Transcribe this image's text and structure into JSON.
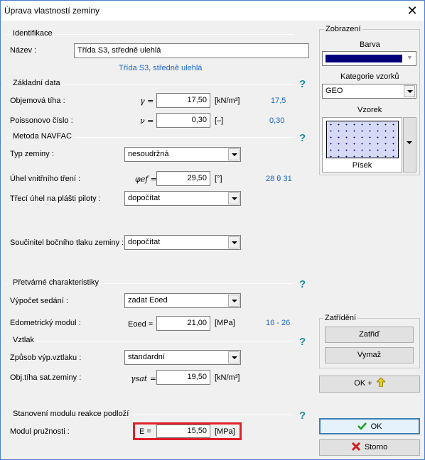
{
  "window": {
    "title": "Úprava vlastností zeminy",
    "close_glyph": "✕"
  },
  "identifikace": {
    "section": "Identifikace",
    "nazev_label": "Název :",
    "nazev_value": "Třída S3, středně ulehlá",
    "nazev_hint": "Třída S3, středně ulehlá"
  },
  "zakladni": {
    "section": "Základní data",
    "help": "?",
    "objem_label": "Objemová tíha :",
    "objem_symbol": "γ =",
    "objem_value": "17,50",
    "objem_unit": "[kN/m³]",
    "objem_hint": "17,5",
    "poisson_label": "Poissonovo číslo :",
    "poisson_symbol": "ν =",
    "poisson_value": "0,30",
    "poisson_unit": "[–]",
    "poisson_hint": "0,30"
  },
  "navfac": {
    "section": "Metoda NAVFAC",
    "help": "?",
    "typ_label": "Typ zeminy :",
    "typ_value": "nesoudržná",
    "uhel_label": "Úhel vnitřního tření :",
    "uhel_symbol": "φef =",
    "uhel_value": "29,50",
    "uhel_unit": "[°]",
    "uhel_hint": "28 θ 31",
    "treci_label": "Třecí úhel na plášti piloty :",
    "treci_value": "dopočítat",
    "soucinitel_label": "Součinitel bočního tlaku zeminy :",
    "soucinitel_value": "dopočítat"
  },
  "pretvarne": {
    "section": "Přetvárné charakteristiky",
    "help": "?",
    "vypocet_label": "Výpočet sedání :",
    "vypocet_value": "zadat Eoed",
    "edo_label": "Edometrický modul :",
    "edo_symbol": "Eoed =",
    "edo_value": "21,00",
    "edo_unit": "[MPa]",
    "edo_hint": "16 - 26"
  },
  "vztlak": {
    "section": "Vztlak",
    "help": "?",
    "zpusob_label": "Způsob výp.vztlaku :",
    "zpusob_value": "standardní",
    "sat_label": "Obj.tíha sat.zeminy :",
    "sat_symbol": "γsat =",
    "sat_value": "19,50",
    "sat_unit": "[kN/m³]"
  },
  "modul": {
    "section": "Stanovení modulu reakce podloží",
    "help": "?",
    "label": "Modul pružnosti :",
    "symbol": "E =",
    "value": "15,50",
    "unit": "[MPa]",
    "highlight_color": "#e0202a"
  },
  "zobrazeni": {
    "title": "Zobrazení",
    "barva_label": "Barva",
    "barva_color": "#00007a",
    "kategorie_label": "Kategorie vzorků",
    "kategorie_value": "GEO",
    "vzorek_label": "Vzorek",
    "vzorek_name": "Písek"
  },
  "zatrideni": {
    "title": "Zatřídění",
    "zatrid_button": "Zatřiď",
    "vymaz_button": "Vymaž"
  },
  "buttons": {
    "ok_plus": "OK +",
    "ok": "OK",
    "storno": "Storno"
  }
}
